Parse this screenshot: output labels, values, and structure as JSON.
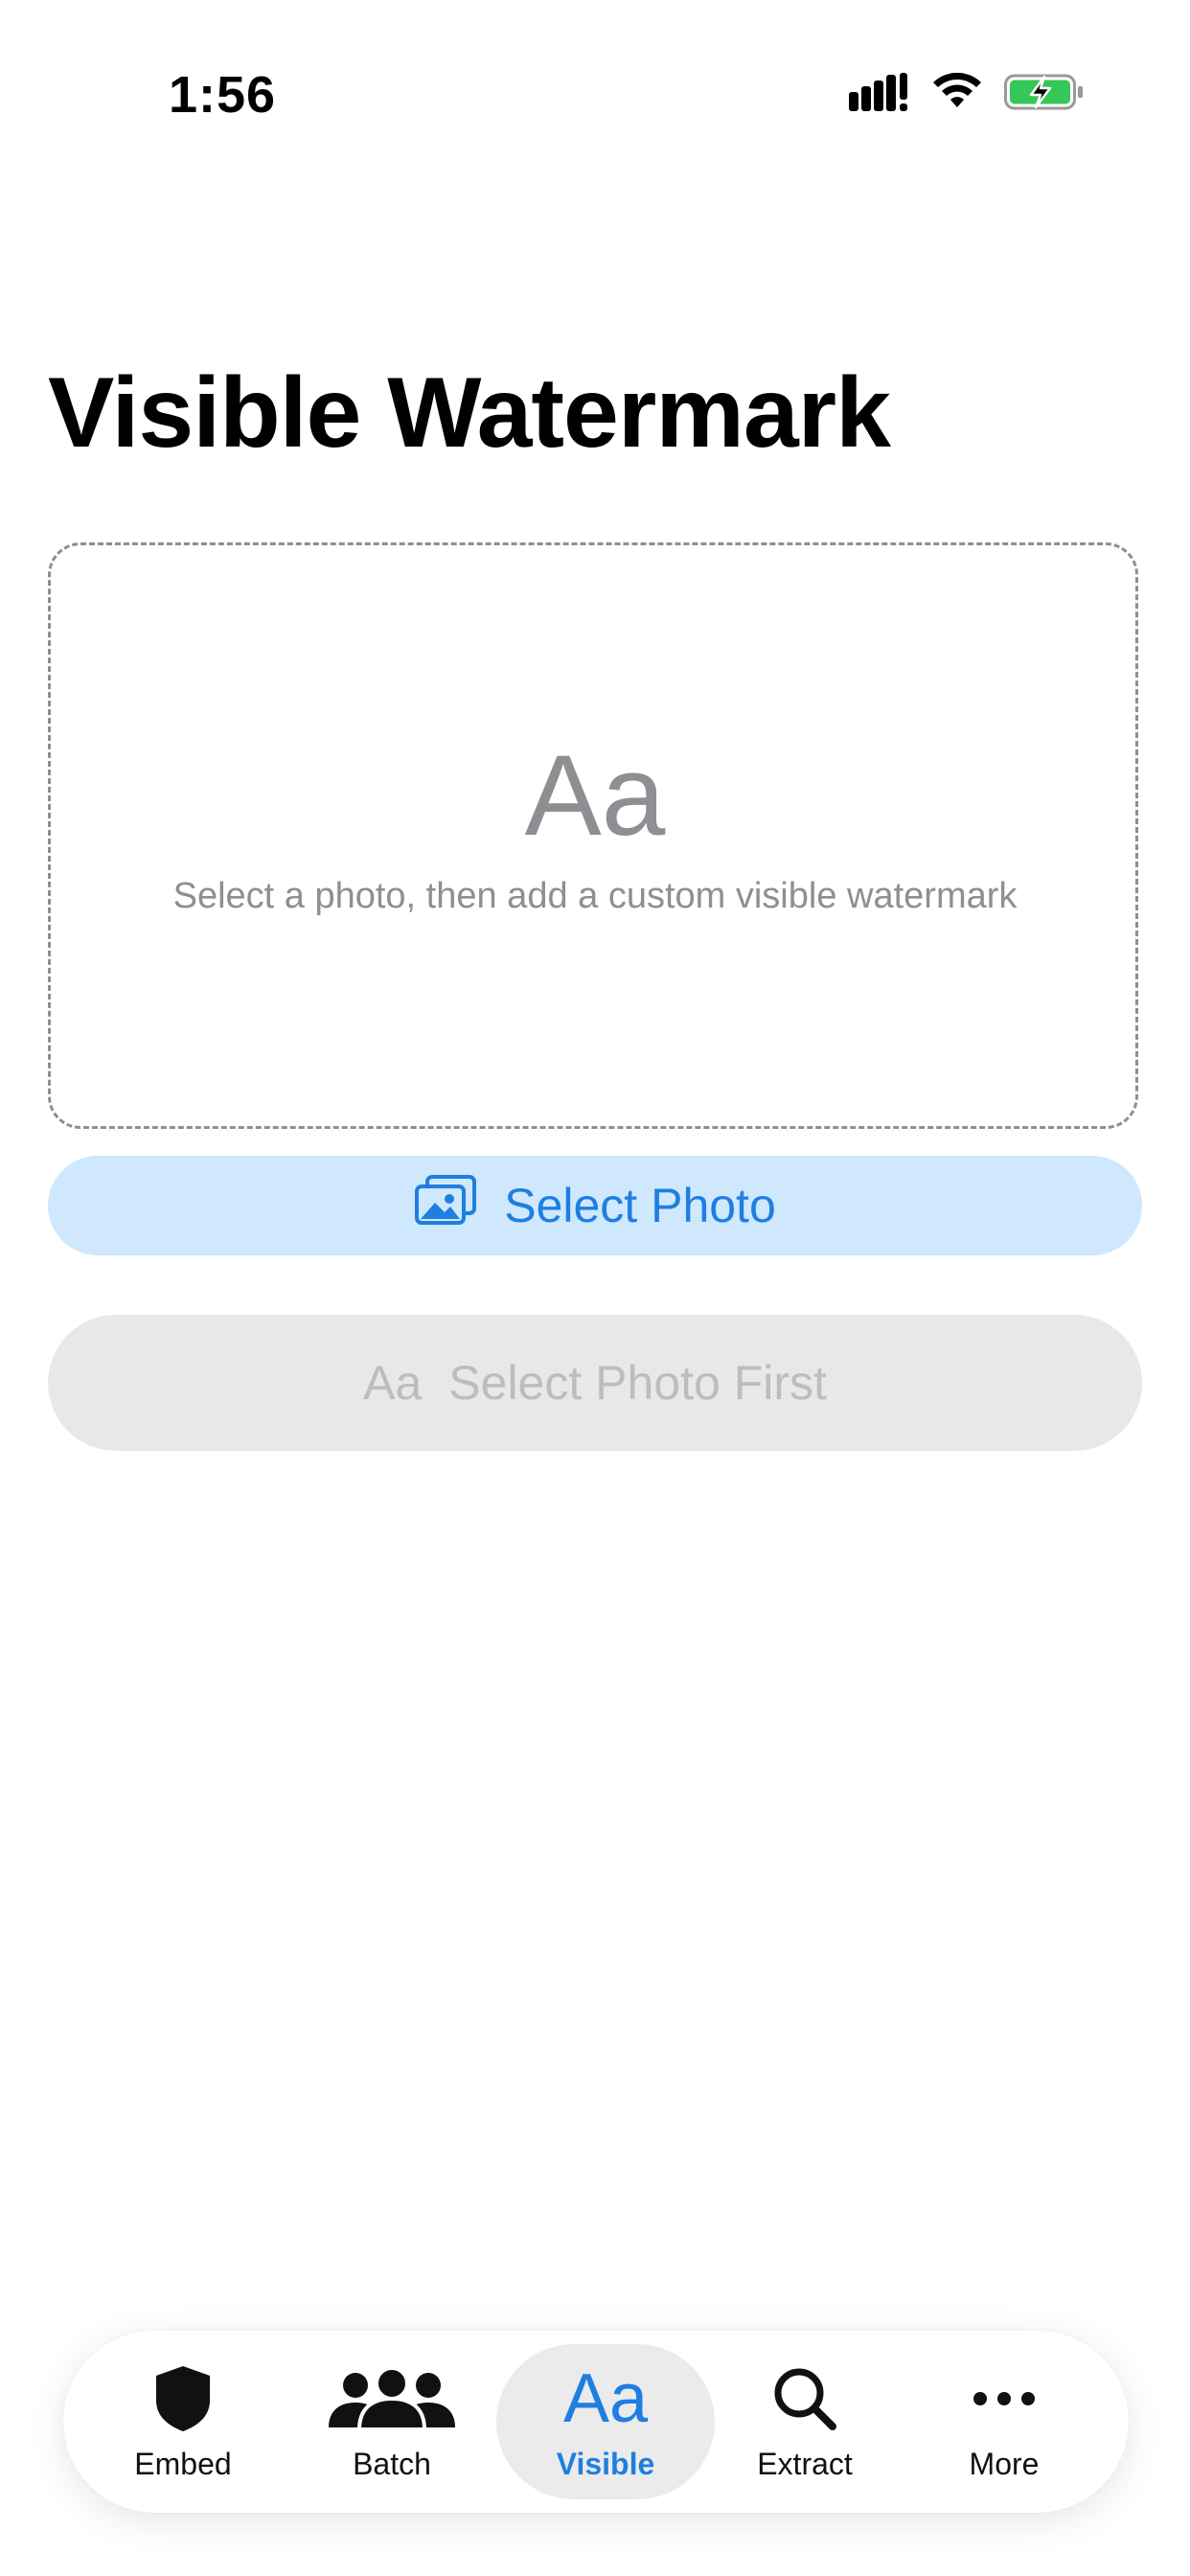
{
  "status_bar": {
    "time": "1:56",
    "icons": [
      "signal-icon",
      "wifi-icon",
      "battery-charging-icon"
    ],
    "battery_color": "#34c759"
  },
  "page": {
    "title": "Visible Watermark"
  },
  "drop_zone": {
    "glyph": "Aa",
    "hint": "Select a photo, then add a custom visible watermark"
  },
  "buttons": {
    "select_photo": {
      "label": "Select Photo",
      "icon": "photos-icon"
    },
    "apply_disabled": {
      "glyph": "Aa",
      "label": "Select Photo First"
    }
  },
  "tab_bar": {
    "accent": "#1e7fe0",
    "tabs": [
      {
        "label": "Embed",
        "icon": "shield-icon"
      },
      {
        "label": "Batch",
        "icon": "people-icon"
      },
      {
        "label": "Visible",
        "icon": "text-format-icon",
        "glyph": "Aa",
        "active": true
      },
      {
        "label": "Extract",
        "icon": "magnifier-icon"
      },
      {
        "label": "More",
        "icon": "ellipsis-icon"
      }
    ]
  }
}
